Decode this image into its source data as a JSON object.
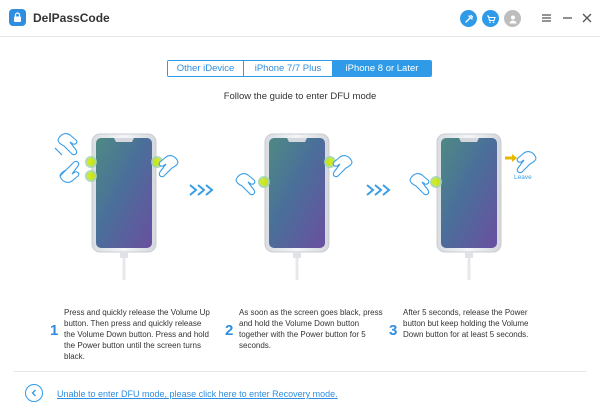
{
  "app": {
    "title": "DelPassCode"
  },
  "tabs": [
    {
      "label": "Other iDevice",
      "active": false
    },
    {
      "label": "iPhone 7/7 Plus",
      "active": false
    },
    {
      "label": "iPhone 8 or Later",
      "active": true
    }
  ],
  "guide_title": "Follow the guide to enter DFU mode",
  "steps": [
    {
      "number": "1",
      "text": "Press and quickly release the Volume Up button. Then press and quickly release the Volume Down button. Press and hold the Power button until the screen turns black."
    },
    {
      "number": "2",
      "text": "As soon as the screen goes black, press and hold the Volume Down button together with the Power button for 5 seconds."
    },
    {
      "number": "3",
      "text": "After 5 seconds, release the Power button but keep holding the Volume Down button for at least 5 seconds."
    }
  ],
  "leave_label": "Leave",
  "recovery_link": "Unable to enter DFU mode, please click here to enter Recovery mode.",
  "colors": {
    "accent": "#2f9be8",
    "highlight": "#c8e600"
  },
  "icons": [
    "app-logo-icon",
    "tools-icon",
    "cart-icon",
    "user-icon",
    "menu-icon",
    "minimize-icon",
    "close-icon",
    "back-arrow-icon",
    "hand-icon",
    "chevrons-icon"
  ]
}
